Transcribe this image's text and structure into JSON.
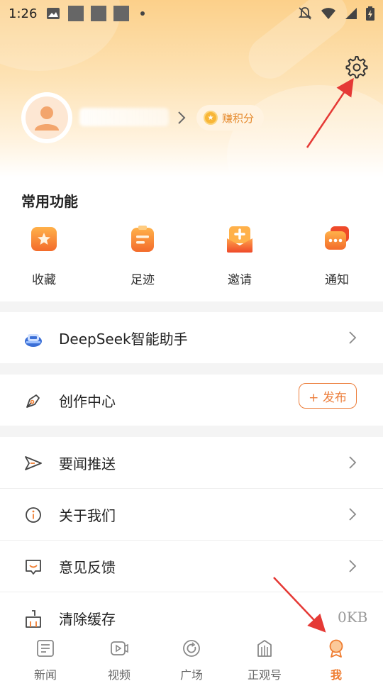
{
  "status_bar": {
    "time": "1:26"
  },
  "profile": {
    "earn_points_label": "赚积分"
  },
  "common_functions": {
    "title": "常用功能",
    "items": [
      {
        "label": "收藏",
        "icon": "favorite-icon"
      },
      {
        "label": "足迹",
        "icon": "footprint-icon"
      },
      {
        "label": "邀请",
        "icon": "invite-icon"
      },
      {
        "label": "通知",
        "icon": "notification-icon"
      }
    ]
  },
  "menu": {
    "deepseek": "DeepSeek智能助手",
    "creation_center": "创作中心",
    "publish_label": "+ 发布",
    "news_push": "要闻推送",
    "about_us": "关于我们",
    "feedback": "意见反馈",
    "clear_cache": "清除缓存",
    "cache_size": "0KB"
  },
  "tabs": [
    {
      "label": "新闻",
      "active": false
    },
    {
      "label": "视频",
      "active": false
    },
    {
      "label": "广场",
      "active": false
    },
    {
      "label": "正观号",
      "active": false
    },
    {
      "label": "我",
      "active": true
    }
  ],
  "colors": {
    "accent": "#ef7d31",
    "hero_top": "#fcd08a",
    "annotation": "#e53935"
  }
}
